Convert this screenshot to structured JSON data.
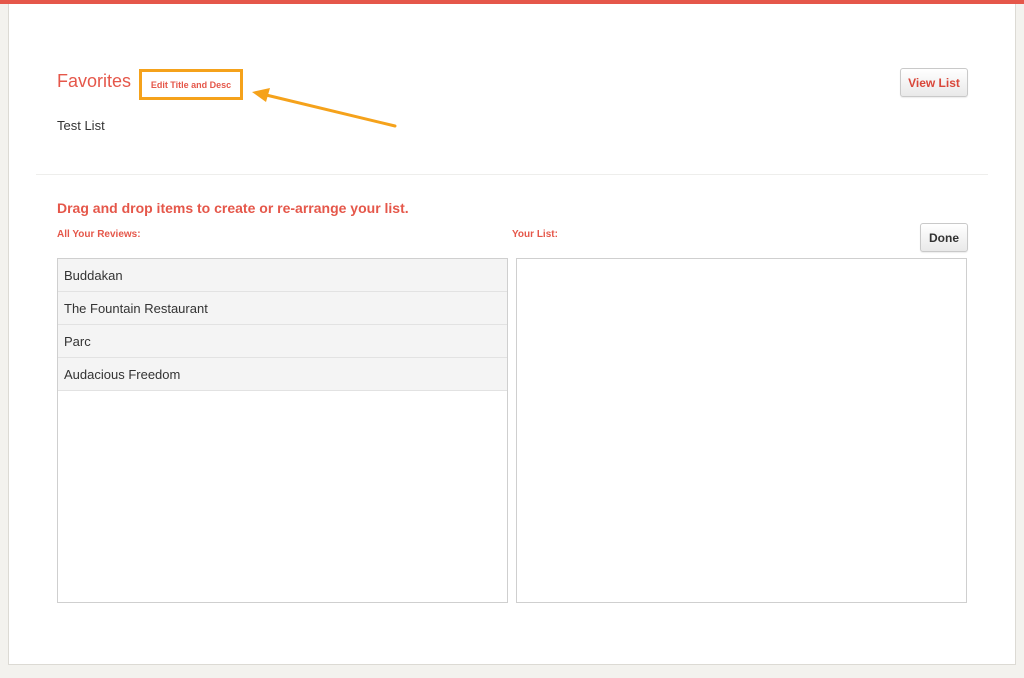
{
  "header": {
    "list_title": "Favorites",
    "edit_link_label": "Edit Title and Desc",
    "list_description": "Test List",
    "view_list_label": "View List"
  },
  "editor": {
    "instructions": "Drag and drop items to create or re-arrange your list.",
    "reviews_label": "All Your Reviews:",
    "your_list_label": "Your List:",
    "done_label": "Done",
    "reviews": [
      {
        "name": "Buddakan"
      },
      {
        "name": "The Fountain Restaurant"
      },
      {
        "name": "Parc"
      },
      {
        "name": "Audacious Freedom"
      }
    ],
    "your_list": []
  },
  "colors": {
    "accent": "#e5574a",
    "highlight": "#f5a21b",
    "page_background": "#f3f2ee"
  },
  "icons": {
    "annotation_arrow": "arrow-left-icon"
  }
}
